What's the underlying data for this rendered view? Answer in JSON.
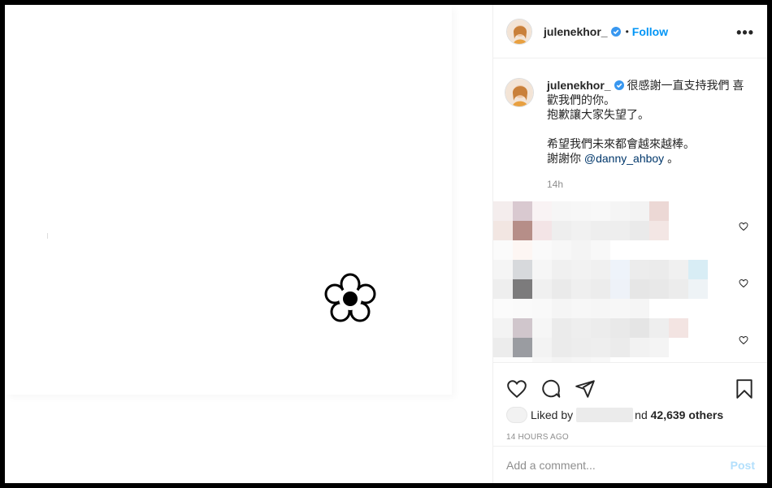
{
  "post": {
    "username": "julenekhor_",
    "follow_label": "Follow",
    "dot": "•",
    "more_label": "•••"
  },
  "caption": {
    "username": "julenekhor_",
    "line1": "很感謝一直支持我們 喜歡我們的你。",
    "line2": "抱歉讓大家失望了。",
    "line3": "希望我們未來都會越來越棒。",
    "line4_prefix": "謝謝你",
    "mention": "@danny_ahboy",
    "line4_suffix": "。",
    "time": "14h"
  },
  "likes": {
    "liked_by_prefix": "Liked by",
    "and_text": "nd",
    "others": "42,639 others"
  },
  "timestamp": "14 HOURS AGO",
  "comment": {
    "placeholder": "Add a comment...",
    "post_label": "Post"
  },
  "colors": {
    "accent": "#0095f6",
    "verified": "#3897f0",
    "post_disabled": "#b2dffc",
    "avatar_orange": "#e8a040"
  },
  "icons": [
    "verified-icon",
    "more-icon",
    "heart-icon",
    "comment-icon",
    "share-icon",
    "bookmark-icon",
    "flower-icon"
  ]
}
